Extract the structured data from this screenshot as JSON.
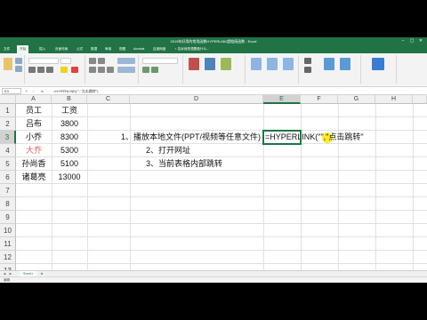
{
  "titlebar": {
    "title": "2019年好用的常用函数HYPERLINK超链接函数 - Excel"
  },
  "ribbon_tabs": [
    "文件",
    "开始",
    "插入",
    "页面布局",
    "公式",
    "数据",
    "审阅",
    "视图",
    "Acrobat",
    "百度网盘",
    "♀ 告诉我您想要做什么..."
  ],
  "formula_bar": {
    "name_box": "E3",
    "fx": "fx",
    "formula": "=HYPERLINK(\"\",\"点击跳转\")"
  },
  "columns": [
    "A",
    "B",
    "C",
    "D",
    "E",
    "F",
    "G",
    "H"
  ],
  "rows": [
    "1",
    "2",
    "3",
    "4",
    "5",
    "6",
    "7",
    "8",
    "9",
    "10",
    "11",
    "12",
    "13",
    "14",
    "15",
    "16"
  ],
  "cells": {
    "A1": "员工",
    "B1": "工资",
    "A2": "吕布",
    "B2": "3800",
    "A3": "小乔",
    "B3": "8300",
    "A4": "大乔",
    "B4": "5300",
    "A5": "孙尚香",
    "B5": "5100",
    "A6": "诸葛亮",
    "B6": "13000",
    "D3": "1、播放本地文件(PPT/视频等任意文件)",
    "D4": "2、打开网址",
    "D5": "3、当前表格内部跳转",
    "E3": "=HYPERLINK(\"\",\"点击跳转\""
  },
  "sheets": [
    "Sheet1"
  ],
  "status": {
    "mode": "编辑"
  },
  "colors": {
    "accent": "#217346",
    "highlight_text": "#e06060",
    "cursor": "#ffe600"
  }
}
